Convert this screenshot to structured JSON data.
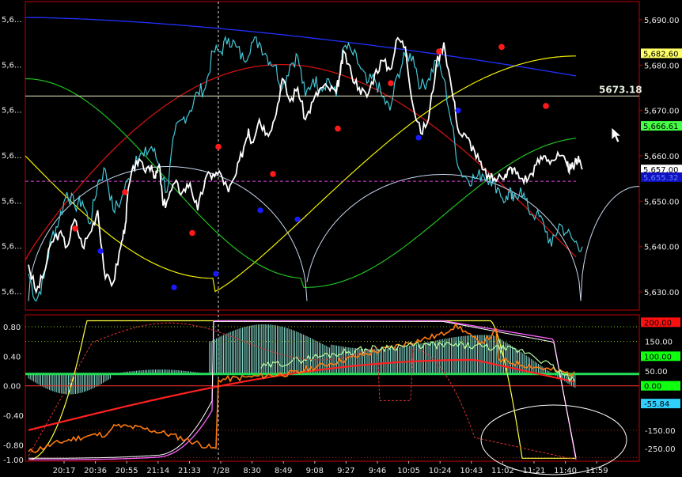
{
  "colors": {
    "background": "#000000",
    "frame": "#c00000",
    "axis_text": "#e8e8e8",
    "price": "#ffffff",
    "cyan_series": "#44c8d8",
    "blue_curve": "#2030ff",
    "red_curve": "#d01010",
    "yellow_curve": "#f0f000",
    "green_curve": "#20c020",
    "arc_curve": "#c8d8f0",
    "swing_high": "#ff1a1a",
    "swing_low": "#1a1aff",
    "histogram": "#8ee6d8",
    "magenta": "#ff50ff",
    "orange": "#ff7a10"
  },
  "chart_data": [
    {
      "type": "line",
      "panel": "price",
      "y_axis_side": "right",
      "ylim": [
        5626,
        5694
      ],
      "y_ticks": [
        "5,630.00",
        "5,640.00",
        "5,650.00",
        "5,660.00",
        "5,670.00",
        "5,680.00",
        "5,690.00"
      ],
      "left_ticks": [
        "5,6...",
        "5,6...",
        "5,6...",
        "5,6...",
        "5,6...",
        "5,6...",
        "5,6..."
      ],
      "grid": false,
      "horizontal_line": {
        "value": 5673.18,
        "label": "5673.18"
      },
      "dashed_line": {
        "value": 5654.4
      },
      "price_tags": [
        {
          "label": "5,682.60",
          "value": 5682.6,
          "bg": "#ffff66",
          "fg": "#000000"
        },
        {
          "label": "5,666.61",
          "value": 5666.61,
          "bg": "#44ff44",
          "fg": "#000000"
        },
        {
          "label": "5,657.00",
          "value": 5657.0,
          "bg": "#ffffff",
          "fg": "#000000"
        },
        {
          "label": "5,655.32",
          "value": 5655.3,
          "bg": "#1010c0",
          "fg": "#6080ff"
        }
      ],
      "series": [
        {
          "name": "",
          "color": "#ffffff",
          "x": [
            0,
            10,
            20,
            30,
            40,
            50,
            60,
            70,
            80,
            90,
            100,
            110,
            120,
            126,
            130,
            140,
            150,
            160,
            165,
            170,
            175,
            180,
            190,
            200,
            210,
            220,
            230,
            240,
            250,
            260,
            270,
            280,
            286,
            290,
            300,
            310,
            320,
            330,
            340,
            350,
            360,
            370,
            380,
            390,
            400,
            405,
            410,
            420,
            430,
            440,
            450,
            460,
            470,
            480,
            490,
            500,
            510,
            520,
            530,
            540,
            550,
            560,
            570,
            580,
            590,
            600,
            610,
            620,
            625,
            630,
            640,
            650,
            660,
            670,
            680,
            690,
            700,
            705,
            710,
            715,
            720
          ],
          "y": [
            5636,
            5630,
            5634,
            5641,
            5643,
            5640,
            5646,
            5640,
            5643,
            5648,
            5633,
            5632,
            5640,
            5645,
            5653,
            5659,
            5657,
            5658,
            5655,
            5658,
            5649,
            5650,
            5654,
            5652,
            5654,
            5648,
            5655,
            5656,
            5656,
            5652,
            5656,
            5662,
            5666,
            5663,
            5668,
            5665,
            5668,
            5677,
            5672,
            5675,
            5668,
            5672,
            5675,
            5675,
            5674,
            5678,
            5683,
            5678,
            5675,
            5673,
            5678,
            5681,
            5679,
            5686,
            5684,
            5671,
            5665,
            5668,
            5680,
            5685,
            5675,
            5665,
            5664,
            5661,
            5657,
            5655,
            5655,
            5656,
            5657,
            5657,
            5655,
            5655,
            5658,
            5660,
            5659,
            5660,
            5658,
            5657,
            5658,
            5660,
            5657
          ]
        },
        {
          "name": "",
          "color": "#44c8d8",
          "x": [
            0,
            10,
            20,
            30,
            40,
            50,
            60,
            70,
            80,
            90,
            100,
            110,
            120,
            130,
            140,
            150,
            160,
            170,
            180,
            190,
            200,
            210,
            220,
            230,
            240,
            250,
            260,
            270,
            280,
            290,
            300,
            310,
            320,
            330,
            340,
            350,
            360,
            370,
            380,
            390,
            400,
            410,
            420,
            430,
            440,
            450,
            460,
            470,
            480,
            490,
            500,
            510,
            520,
            530,
            540,
            550,
            560,
            570,
            580,
            590,
            600,
            610,
            620,
            625,
            630,
            640,
            650,
            660,
            670,
            680,
            690,
            700,
            710,
            720
          ],
          "y": [
            5634,
            5628,
            5633,
            5642,
            5646,
            5652,
            5649,
            5650,
            5645,
            5654,
            5657,
            5648,
            5650,
            5655,
            5660,
            5660,
            5662,
            5658,
            5652,
            5665,
            5668,
            5670,
            5674,
            5675,
            5683,
            5683,
            5686,
            5684,
            5681,
            5685,
            5685,
            5682,
            5680,
            5675,
            5680,
            5682,
            5673,
            5677,
            5675,
            5677,
            5673,
            5684,
            5683,
            5680,
            5676,
            5677,
            5673,
            5670,
            5678,
            5682,
            5682,
            5675,
            5677,
            5681,
            5677,
            5667,
            5657,
            5655,
            5655,
            5656,
            5655,
            5653,
            5650,
            5652,
            5650,
            5653,
            5648,
            5647,
            5645,
            5640,
            5645,
            5643,
            5641,
            5640
          ]
        }
      ],
      "markers": {
        "highs_color": "#ff1a1a",
        "lows_color": "#1a1aff"
      }
    },
    {
      "type": "area",
      "panel": "oscillator",
      "ylim": [
        -1.02,
        0.96
      ],
      "y_ticks": [
        "0.80",
        "0.40",
        "0.00",
        "-0.40",
        "-0.80",
        "-1.00"
      ],
      "left_ticks": [
        "0.80",
        "0.40",
        "0.00",
        "-0.40",
        "-0.80",
        "-1.00"
      ],
      "right_ticks": [
        "150.00",
        "50.00",
        "-150.00",
        "-250.00"
      ],
      "right_tags": [
        {
          "label": "200.00",
          "bg": "#ff1010",
          "fg": "#000000"
        },
        {
          "label": "100.00",
          "bg": "#10ff10",
          "fg": "#000000"
        },
        {
          "label": "0.00",
          "bg": "#10ff10",
          "fg": "#000000"
        },
        {
          "label": "-55.84",
          "bg": "#30d0ff",
          "fg": "#000000"
        }
      ],
      "x_ticks": [
        "20:17",
        "20:36",
        "20:55",
        "21:14",
        "21:33",
        "7/28",
        "8:30",
        "8:49",
        "9:08",
        "9:27",
        "9:46",
        "10:05",
        "10:24",
        "10:43",
        "11:02",
        "11:21",
        "11:40",
        "11:59"
      ]
    }
  ]
}
